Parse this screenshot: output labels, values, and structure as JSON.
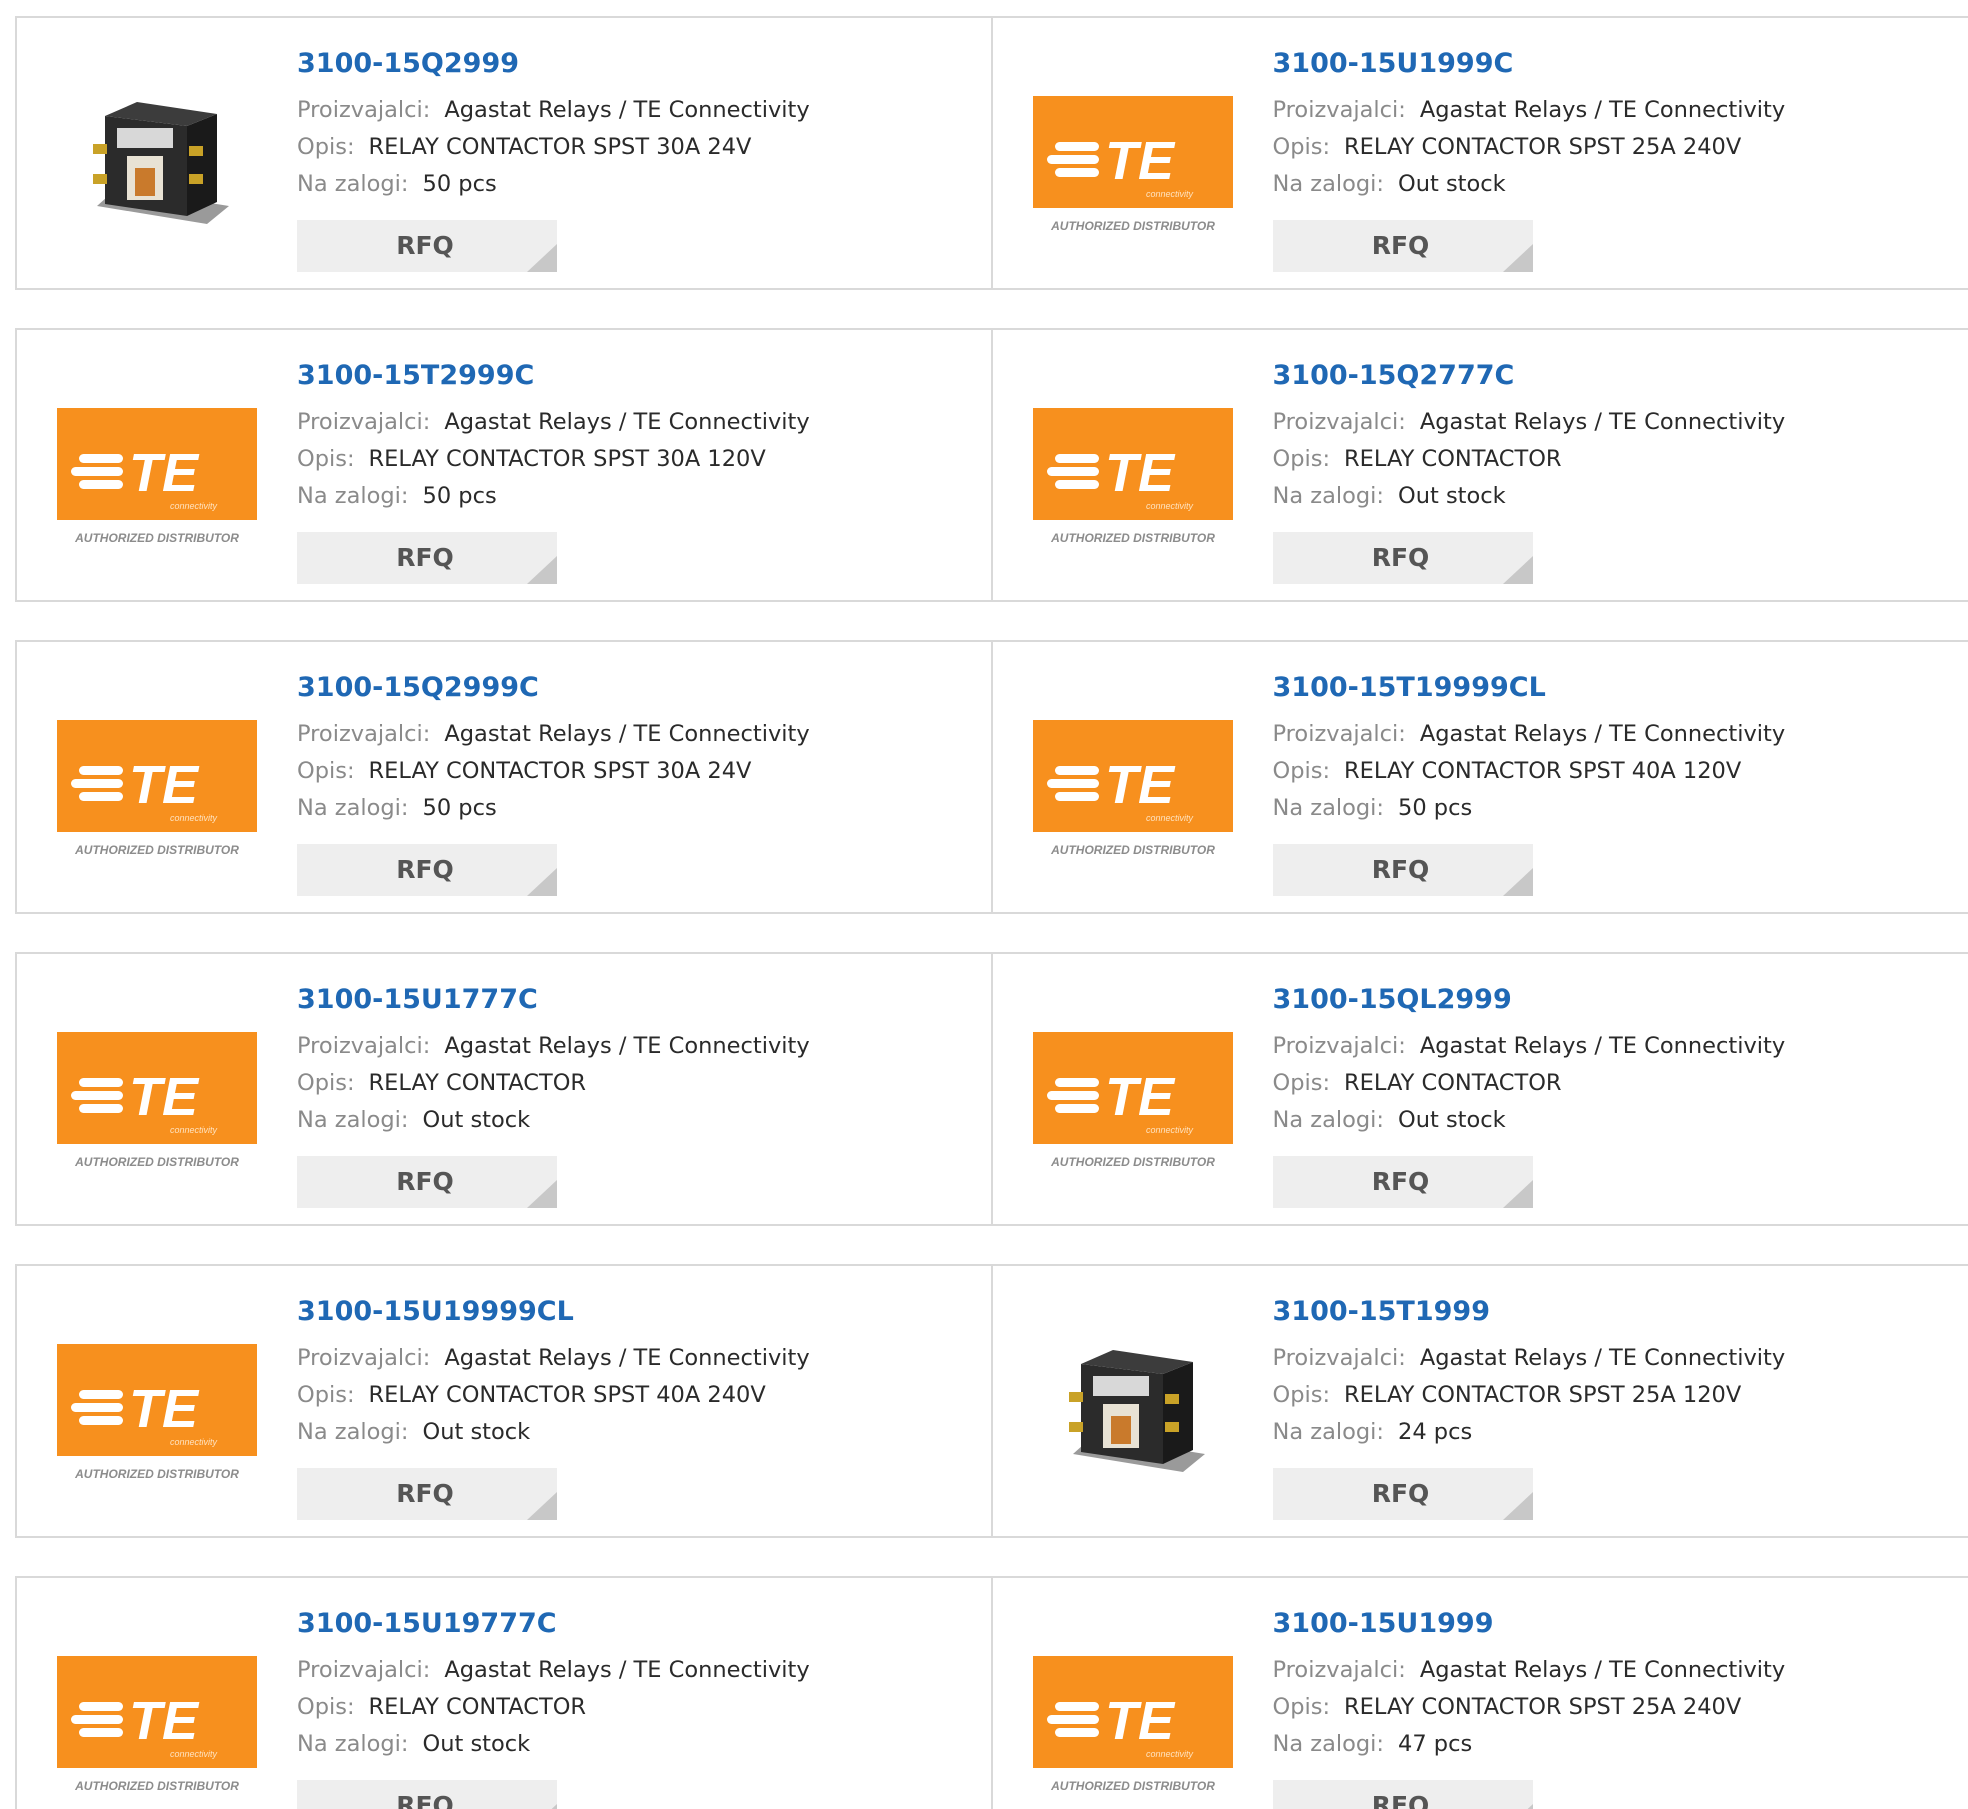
{
  "labels": {
    "manufacturer": "Proizvajalci:",
    "description": "Opis:",
    "stock": "Na zalogi:",
    "rfq": "RFQ"
  },
  "colors": {
    "part_link": "#1f68b4",
    "te_orange": "#f7901e",
    "rfq_bg": "#eeeeee"
  },
  "logo": {
    "brand": "TE",
    "sub": "connectivity",
    "caption": "AUTHORIZED DISTRIBUTOR"
  },
  "products": [
    {
      "part": "3100-15Q2999",
      "manufacturer": "Agastat Relays / TE Connectivity",
      "description": "RELAY CONTACTOR SPST 30A 24V",
      "stock": "50 pcs",
      "image": "relay-photo-1"
    },
    {
      "part": "3100-15U1999C",
      "manufacturer": "Agastat Relays / TE Connectivity",
      "description": "RELAY CONTACTOR SPST 25A 240V",
      "stock": "Out stock",
      "image": "te-logo"
    },
    {
      "part": "3100-15T2999C",
      "manufacturer": "Agastat Relays / TE Connectivity",
      "description": "RELAY CONTACTOR SPST 30A 120V",
      "stock": "50 pcs",
      "image": "te-logo"
    },
    {
      "part": "3100-15Q2777C",
      "manufacturer": "Agastat Relays / TE Connectivity",
      "description": "RELAY CONTACTOR",
      "stock": "Out stock",
      "image": "te-logo"
    },
    {
      "part": "3100-15Q2999C",
      "manufacturer": "Agastat Relays / TE Connectivity",
      "description": "RELAY CONTACTOR SPST 30A 24V",
      "stock": "50 pcs",
      "image": "te-logo"
    },
    {
      "part": "3100-15T19999CL",
      "manufacturer": "Agastat Relays / TE Connectivity",
      "description": "RELAY CONTACTOR SPST 40A 120V",
      "stock": "50 pcs",
      "image": "te-logo"
    },
    {
      "part": "3100-15U1777C",
      "manufacturer": "Agastat Relays / TE Connectivity",
      "description": "RELAY CONTACTOR",
      "stock": "Out stock",
      "image": "te-logo"
    },
    {
      "part": "3100-15QL2999",
      "manufacturer": "Agastat Relays / TE Connectivity",
      "description": "RELAY CONTACTOR",
      "stock": "Out stock",
      "image": "te-logo"
    },
    {
      "part": "3100-15U19999CL",
      "manufacturer": "Agastat Relays / TE Connectivity",
      "description": "RELAY CONTACTOR SPST 40A 240V",
      "stock": "Out stock",
      "image": "te-logo"
    },
    {
      "part": "3100-15T1999",
      "manufacturer": "Agastat Relays / TE Connectivity",
      "description": "RELAY CONTACTOR SPST 25A 120V",
      "stock": "24 pcs",
      "image": "relay-photo-2"
    },
    {
      "part": "3100-15U19777C",
      "manufacturer": "Agastat Relays / TE Connectivity",
      "description": "RELAY CONTACTOR",
      "stock": "Out stock",
      "image": "te-logo"
    },
    {
      "part": "3100-15U1999",
      "manufacturer": "Agastat Relays / TE Connectivity",
      "description": "RELAY CONTACTOR SPST 25A 240V",
      "stock": "47 pcs",
      "image": "te-logo"
    }
  ]
}
